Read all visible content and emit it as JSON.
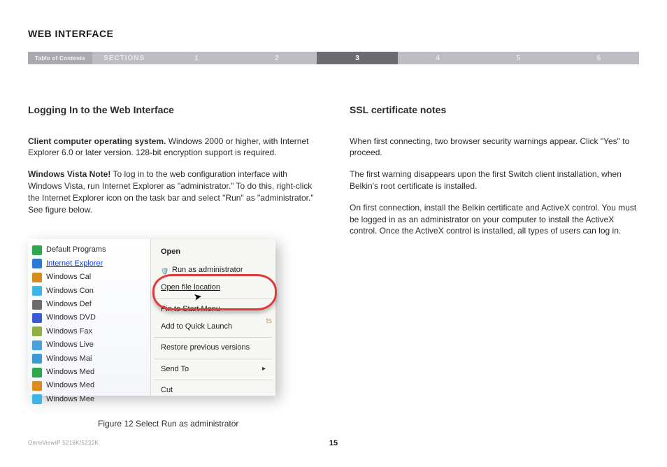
{
  "header": {
    "title": "WEB INTERFACE",
    "toc": "Table of Contents",
    "sections": "SECTIONS",
    "nums": [
      "1",
      "2",
      "3",
      "4",
      "5",
      "6"
    ],
    "active_index": 2
  },
  "left": {
    "heading": "Logging In to the Web Interface",
    "p1_bold": "Client computer operating system.",
    "p1_rest": " Windows 2000 or higher, with Internet Explorer 6.0 or later version. 128-bit encryption support is required.",
    "p2_bold": "Windows Vista Note!",
    "p2_rest": " To log in to the web configuration interface with Windows Vista, run Internet Explorer as \"administrator.\" To do this, right-click the Internet Explorer icon on the task bar and select \"Run\" as \"administrator.\" See figure below.",
    "figure_caption": "Figure 12 Select Run as administrator"
  },
  "right": {
    "heading": "SSL certificate notes",
    "p1": "When first connecting, two browser security warnings appear. Click \"Yes\" to proceed.",
    "p2": "The first warning disappears upon the first Switch client installation, when Belkin's root certificate is installed.",
    "p3": "On first connection, install the Belkin certificate and ActiveX control. You must be logged in as an administrator on your computer to install the ActiveX control. Once the ActiveX control is installed, all types of users can log in."
  },
  "figure": {
    "start_items": [
      {
        "label": "Default Programs",
        "color": "#2aa84b"
      },
      {
        "label": "Internet Explorer",
        "color": "#2a7bd4",
        "highlight": true
      },
      {
        "label": "Windows Cal",
        "color": "#d68b1d"
      },
      {
        "label": "Windows Con",
        "color": "#3bb4e6"
      },
      {
        "label": "Windows Def",
        "color": "#6c6c6c"
      },
      {
        "label": "Windows DVD",
        "color": "#3b5bd4"
      },
      {
        "label": "Windows Fax",
        "color": "#8fb23c"
      },
      {
        "label": "Windows Live",
        "color": "#4aa3d8"
      },
      {
        "label": "Windows Mai",
        "color": "#3b9ad4"
      },
      {
        "label": "Windows Med",
        "color": "#2aa84b"
      },
      {
        "label": "Windows Med",
        "color": "#e08a1d"
      },
      {
        "label": "Windows Mee",
        "color": "#3bb4e6"
      }
    ],
    "ctx": {
      "open": "Open",
      "run_admin": "Run as administrator",
      "open_loc": "Open file location",
      "pin": "Pin to Start Menu",
      "quick": "Add to Quick Launch",
      "restore": "Restore previous versions",
      "send": "Send To",
      "cut": "Cut"
    },
    "black_text": "ts"
  },
  "footer": {
    "model": "OmniViewIP 5216K/5232K",
    "page": "15"
  }
}
